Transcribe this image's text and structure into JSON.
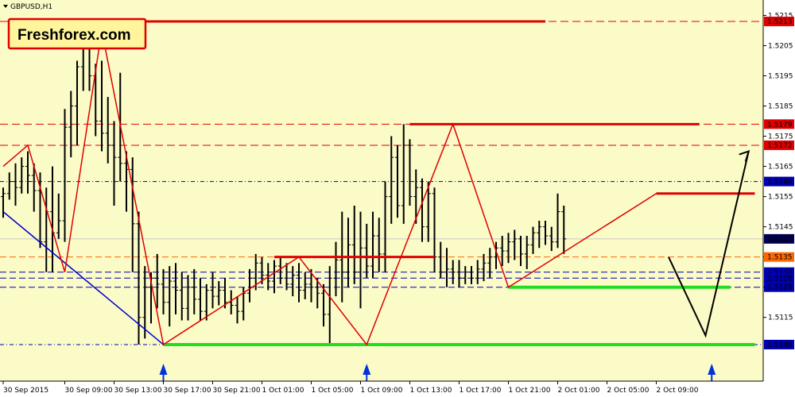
{
  "window": {
    "symbol_timeframe": "GBPUSD,H1",
    "brand_label": "Freshforex.com"
  },
  "colors": {
    "background": "#FBFBC8",
    "bar": "#000000",
    "resistance": "#E00000",
    "support": "#0000B0",
    "green_level": "#22DD22",
    "zigzag": "#E00000",
    "blue_trendline": "#0000CC",
    "forecast": "#000000",
    "arrow": "#0033DD",
    "brand_bg": "#FFF59D",
    "brand_border": "#E00000"
  },
  "chart_data": {
    "type": "ohlc",
    "title": "GBPUSD,H1",
    "ylim": [
      1.5096,
      1.5218
    ],
    "y_ticks": [
      "1.5215",
      "1.5205",
      "1.5195",
      "1.5185",
      "1.5175",
      "1.5165",
      "1.5155",
      "1.5145",
      "1.5135",
      "1.5125",
      "1.5115"
    ],
    "x_tick_labels": [
      "30 Sep 2015",
      "30 Sep 09:00",
      "30 Sep 13:00",
      "30 Sep 17:00",
      "30 Sep 21:00",
      "1 Oct 01:00",
      "1 Oct 05:00",
      "1 Oct 09:00",
      "1 Oct 13:00",
      "1 Oct 17:00",
      "1 Oct 21:00",
      "2 Oct 01:00",
      "2 Oct 05:00",
      "2 Oct 09:00"
    ],
    "price_labels": [
      {
        "value": "1.5213",
        "price": 1.5213,
        "style": "red"
      },
      {
        "value": "1.5179",
        "price": 1.5179,
        "style": "red"
      },
      {
        "value": "1.5172",
        "price": 1.5172,
        "style": "red"
      },
      {
        "value": "1.5160",
        "price": 1.516,
        "style": "blue"
      },
      {
        "value": "1.5141",
        "price": 1.5141,
        "style": "dark"
      },
      {
        "value": "1.5135",
        "price": 1.5135,
        "style": "orange"
      },
      {
        "value": "1.5130",
        "price": 1.513,
        "style": "blue"
      },
      {
        "value": "1.5128",
        "price": 1.5128,
        "style": "blue"
      },
      {
        "value": "1.5125",
        "price": 1.5125,
        "style": "blue"
      },
      {
        "value": "1.5106",
        "price": 1.5106,
        "style": "blue"
      }
    ],
    "ohlc": [
      [
        1.5155,
        1.5158,
        1.5148,
        1.5156
      ],
      [
        1.5156,
        1.5163,
        1.5154,
        1.516
      ],
      [
        1.516,
        1.5166,
        1.5152,
        1.5158
      ],
      [
        1.5158,
        1.5168,
        1.5156,
        1.5165
      ],
      [
        1.5165,
        1.517,
        1.5156,
        1.5162
      ],
      [
        1.5162,
        1.5166,
        1.515,
        1.5157
      ],
      [
        1.5157,
        1.5163,
        1.5138,
        1.514
      ],
      [
        1.514,
        1.5158,
        1.513,
        1.515
      ],
      [
        1.515,
        1.5165,
        1.513,
        1.5143
      ],
      [
        1.5143,
        1.5156,
        1.5141,
        1.5147
      ],
      [
        1.5147,
        1.5184,
        1.514,
        1.5178
      ],
      [
        1.5178,
        1.519,
        1.5168,
        1.5185
      ],
      [
        1.5185,
        1.52,
        1.5172,
        1.5198
      ],
      [
        1.5198,
        1.521,
        1.519,
        1.5205
      ],
      [
        1.5205,
        1.5212,
        1.519,
        1.5195
      ],
      [
        1.5195,
        1.5199,
        1.5175,
        1.518
      ],
      [
        1.518,
        1.52,
        1.517,
        1.5176
      ],
      [
        1.5176,
        1.5188,
        1.5166,
        1.5172
      ],
      [
        1.5172,
        1.518,
        1.5152,
        1.5168
      ],
      [
        1.5168,
        1.5196,
        1.516,
        1.5166
      ],
      [
        1.5166,
        1.517,
        1.515,
        1.5164
      ],
      [
        1.5164,
        1.5168,
        1.513,
        1.5146
      ],
      [
        1.5146,
        1.515,
        1.5106,
        1.5115
      ],
      [
        1.5115,
        1.5132,
        1.5108,
        1.5125
      ],
      [
        1.5125,
        1.513,
        1.5113,
        1.5128
      ],
      [
        1.5128,
        1.5136,
        1.5118,
        1.5126
      ],
      [
        1.5126,
        1.5131,
        1.5116,
        1.512
      ],
      [
        1.512,
        1.5132,
        1.5112,
        1.5127
      ],
      [
        1.5127,
        1.5133,
        1.5116,
        1.5124
      ],
      [
        1.5124,
        1.513,
        1.5114,
        1.5118
      ],
      [
        1.5118,
        1.5129,
        1.5114,
        1.5125
      ],
      [
        1.5125,
        1.5131,
        1.5116,
        1.5121
      ],
      [
        1.5121,
        1.5128,
        1.5114,
        1.5117
      ],
      [
        1.5117,
        1.5126,
        1.5114,
        1.5124
      ],
      [
        1.5124,
        1.513,
        1.5118,
        1.5122
      ],
      [
        1.5122,
        1.5127,
        1.5119,
        1.5124
      ],
      [
        1.5124,
        1.5128,
        1.5118,
        1.512
      ],
      [
        1.512,
        1.5124,
        1.5116,
        1.5119
      ],
      [
        1.5119,
        1.5122,
        1.5113,
        1.5117
      ],
      [
        1.5117,
        1.5125,
        1.5114,
        1.5123
      ],
      [
        1.5123,
        1.5131,
        1.512,
        1.5128
      ],
      [
        1.5128,
        1.5136,
        1.5124,
        1.5133
      ],
      [
        1.5133,
        1.5135,
        1.5126,
        1.5129
      ],
      [
        1.5129,
        1.5133,
        1.5124,
        1.5127
      ],
      [
        1.5127,
        1.5134,
        1.5123,
        1.5132
      ],
      [
        1.5132,
        1.5135,
        1.5126,
        1.5128
      ],
      [
        1.5128,
        1.5133,
        1.5124,
        1.5126
      ],
      [
        1.5126,
        1.5132,
        1.5122,
        1.5129
      ],
      [
        1.5129,
        1.5133,
        1.512,
        1.5124
      ],
      [
        1.5124,
        1.513,
        1.5121,
        1.5126
      ],
      [
        1.5126,
        1.5131,
        1.512,
        1.5125
      ],
      [
        1.5125,
        1.5128,
        1.5118,
        1.5123
      ],
      [
        1.5123,
        1.5126,
        1.5112,
        1.5116
      ],
      [
        1.5116,
        1.5132,
        1.5106,
        1.5128
      ],
      [
        1.5128,
        1.514,
        1.5122,
        1.5134
      ],
      [
        1.5134,
        1.515,
        1.512,
        1.513
      ],
      [
        1.513,
        1.5148,
        1.5125,
        1.5139
      ],
      [
        1.5139,
        1.5152,
        1.5126,
        1.513
      ],
      [
        1.513,
        1.515,
        1.5118,
        1.5138
      ],
      [
        1.5138,
        1.5146,
        1.5128,
        1.5132
      ],
      [
        1.5132,
        1.515,
        1.5128,
        1.5142
      ],
      [
        1.5142,
        1.5148,
        1.513,
        1.5136
      ],
      [
        1.5136,
        1.516,
        1.513,
        1.5155
      ],
      [
        1.5155,
        1.5175,
        1.5146,
        1.5168
      ],
      [
        1.5168,
        1.5172,
        1.5148,
        1.5152
      ],
      [
        1.5152,
        1.5179,
        1.5146,
        1.5172
      ],
      [
        1.5172,
        1.5174,
        1.5152,
        1.5155
      ],
      [
        1.5155,
        1.5164,
        1.5146,
        1.5158
      ],
      [
        1.5158,
        1.5161,
        1.514,
        1.5145
      ],
      [
        1.5145,
        1.516,
        1.514,
        1.5156
      ],
      [
        1.5156,
        1.5158,
        1.513,
        1.5135
      ],
      [
        1.5135,
        1.514,
        1.5128,
        1.513
      ],
      [
        1.513,
        1.5138,
        1.5125,
        1.5131
      ],
      [
        1.5131,
        1.5134,
        1.5126,
        1.513
      ],
      [
        1.513,
        1.5134,
        1.5125,
        1.5128
      ],
      [
        1.5128,
        1.5132,
        1.5126,
        1.513
      ],
      [
        1.513,
        1.5132,
        1.5126,
        1.5128
      ],
      [
        1.5128,
        1.5134,
        1.5126,
        1.5131
      ],
      [
        1.5131,
        1.5136,
        1.5127,
        1.5133
      ],
      [
        1.5133,
        1.5138,
        1.5128,
        1.5135
      ],
      [
        1.5135,
        1.514,
        1.5131,
        1.5138
      ],
      [
        1.5138,
        1.5142,
        1.5132,
        1.5137
      ],
      [
        1.5137,
        1.5143,
        1.5133,
        1.514
      ],
      [
        1.514,
        1.5144,
        1.5134,
        1.5141
      ],
      [
        1.5141,
        1.5142,
        1.5132,
        1.5136
      ],
      [
        1.5136,
        1.5142,
        1.5131,
        1.5139
      ],
      [
        1.5139,
        1.5145,
        1.5136,
        1.5143
      ],
      [
        1.5143,
        1.5147,
        1.5138,
        1.5145
      ],
      [
        1.5145,
        1.5147,
        1.5139,
        1.5142
      ],
      [
        1.5142,
        1.5145,
        1.5137,
        1.514
      ],
      [
        1.514,
        1.5156,
        1.5138,
        1.515
      ],
      [
        1.515,
        1.5152,
        1.5136,
        1.5141
      ]
    ],
    "horizontal_levels": [
      {
        "price": 1.5213,
        "style": "red-dash"
      },
      {
        "price": 1.5179,
        "style": "red-dash"
      },
      {
        "price": 1.5172,
        "style": "red-dash"
      },
      {
        "price": 1.516,
        "style": "blue-dashdot"
      },
      {
        "price": 1.5141,
        "style": "thin"
      },
      {
        "price": 1.5135,
        "style": "orange-dash"
      },
      {
        "price": 1.513,
        "style": "blue-dash"
      },
      {
        "price": 1.5128,
        "style": "blue-dash"
      },
      {
        "price": 1.5125,
        "style": "blue-dash"
      },
      {
        "price": 1.5106,
        "style": "blue-dashdot"
      }
    ],
    "resistance_segments": [
      {
        "price": 1.5213,
        "from_bar": 14,
        "to_bar": 88
      },
      {
        "price": 1.5179,
        "from_bar": 66,
        "to_bar": 113
      },
      {
        "price": 1.5135,
        "from_bar": 44,
        "to_bar": 70
      },
      {
        "price": 1.5156,
        "from_bar": 106,
        "to_bar": 122
      }
    ],
    "support_segments": [
      {
        "price": 1.5125,
        "from_bar": 82,
        "to_bar": 118
      },
      {
        "price": 1.5106,
        "from_bar": 26,
        "to_bar": 122
      }
    ],
    "zigzag": [
      [
        0,
        1.5165
      ],
      [
        4,
        1.5172
      ],
      [
        10,
        1.513
      ],
      [
        16,
        1.521
      ],
      [
        26,
        1.5106
      ],
      [
        48,
        1.5135
      ],
      [
        59,
        1.5106
      ],
      [
        73,
        1.5179
      ],
      [
        82,
        1.5125
      ],
      [
        106,
        1.5156
      ]
    ],
    "blue_trendline": [
      [
        0,
        1.515
      ],
      [
        26,
        1.5106
      ]
    ],
    "forecast_path": [
      [
        108,
        1.5135
      ],
      [
        114,
        1.5109
      ],
      [
        121,
        1.517
      ]
    ],
    "up_arrows": [
      26,
      59,
      115
    ]
  }
}
